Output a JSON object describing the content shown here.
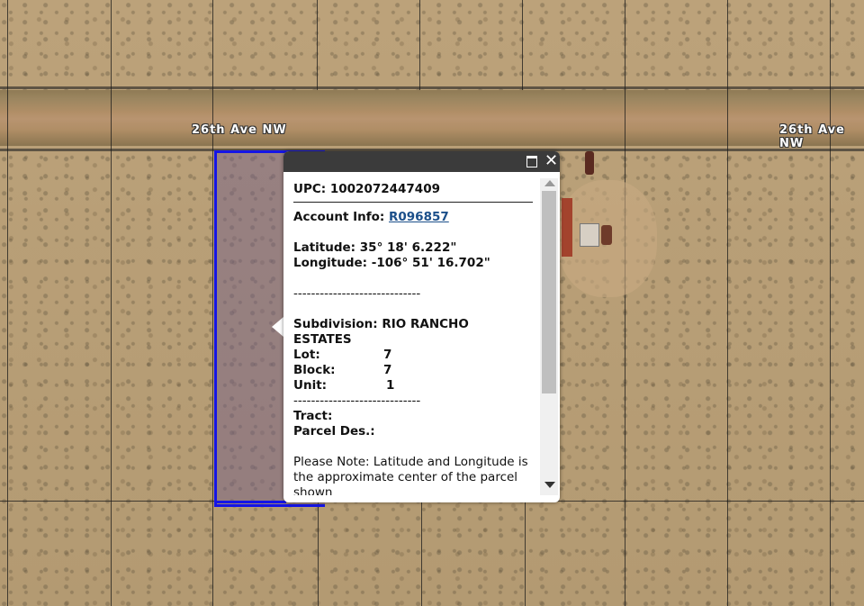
{
  "map": {
    "road_name": "26th Ave NW",
    "parcel_outline_color": "#1414e6"
  },
  "popup": {
    "upc_label": "UPC:",
    "upc_value": "1002072447409",
    "account_label": "Account Info:",
    "account_value": "R096857",
    "latitude_label": "Latitude:",
    "latitude_value": "35° 18' 6.222\"",
    "longitude_label": "Longitude:",
    "longitude_value": "-106° 51' 16.702\"",
    "separator": "-----------------------------",
    "subdivision_label": "Subdivision:",
    "subdivision_value_1": "RIO RANCHO",
    "subdivision_value_2": "ESTATES",
    "lot_label": "Lot:",
    "lot_value": "7",
    "block_label": "Block:",
    "block_value": "7",
    "unit_label": "Unit:",
    "unit_value": "1",
    "tract_label": "Tract:",
    "parcel_des_label": "Parcel Des.:",
    "note_line_1": "Please Note: Latitude and Longitude is",
    "note_line_2": "the approximate center of the parcel",
    "note_line_3": "shown"
  }
}
